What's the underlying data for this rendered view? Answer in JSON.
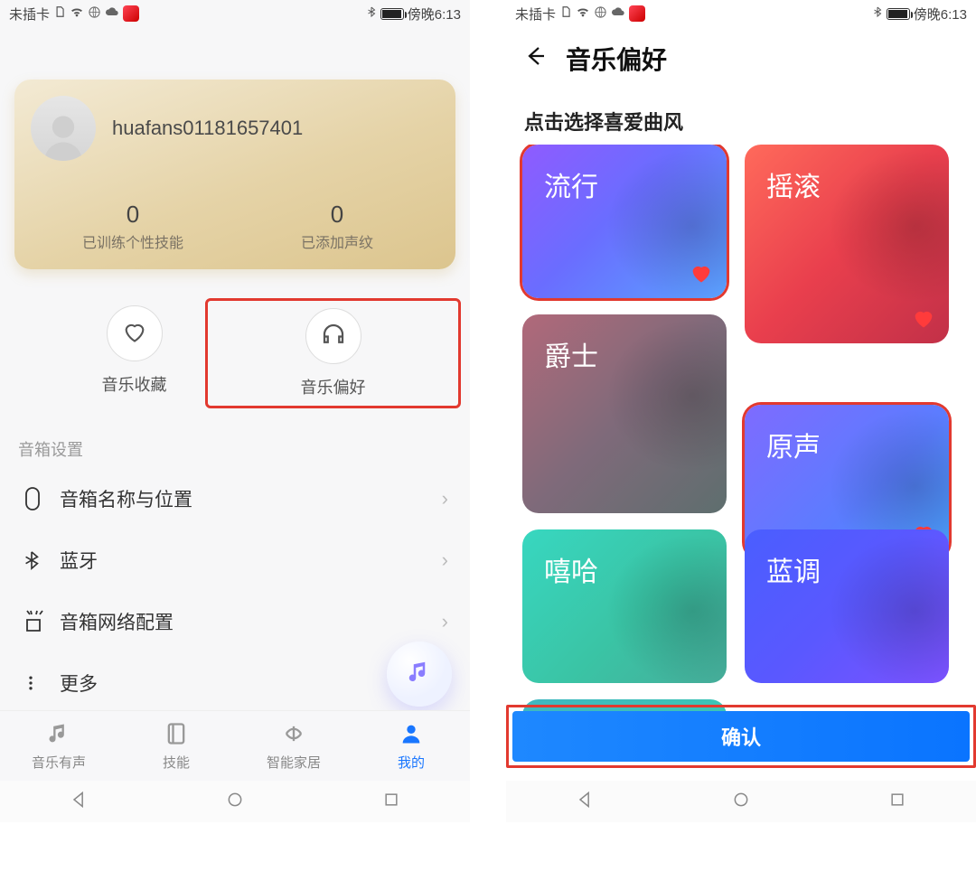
{
  "status": {
    "sim_text": "未插卡",
    "time_text": "傍晚6:13"
  },
  "left": {
    "username": "huafans01181657401",
    "stats": [
      {
        "value": "0",
        "label": "已训练个性技能"
      },
      {
        "value": "0",
        "label": "已添加声纹"
      }
    ],
    "round_actions": [
      {
        "label": "音乐收藏",
        "icon": "heart"
      },
      {
        "label": "音乐偏好",
        "icon": "headphones"
      }
    ],
    "section_title": "音箱设置",
    "settings": [
      {
        "label": "音箱名称与位置",
        "icon": "speaker"
      },
      {
        "label": "蓝牙",
        "icon": "bluetooth"
      },
      {
        "label": "音箱网络配置",
        "icon": "router"
      },
      {
        "label": "更多",
        "icon": "more"
      }
    ],
    "tabs": [
      {
        "label": "音乐有声",
        "icon": "music"
      },
      {
        "label": "技能",
        "icon": "book"
      },
      {
        "label": "智能家居",
        "icon": "home"
      },
      {
        "label": "我的",
        "icon": "person",
        "active": true
      }
    ]
  },
  "right": {
    "header_title": "音乐偏好",
    "sub_title": "点击选择喜爱曲风",
    "genres": [
      {
        "name": "流行",
        "key": "popular",
        "liked": true,
        "highlighted": true
      },
      {
        "name": "摇滚",
        "key": "rock",
        "liked": true,
        "highlighted": false
      },
      {
        "name": "爵士",
        "key": "jazz",
        "liked": false,
        "highlighted": false
      },
      {
        "name": "原声",
        "key": "soundtrack",
        "liked": true,
        "highlighted": true
      },
      {
        "name": "嘻哈",
        "key": "hiphop",
        "liked": false,
        "highlighted": false
      },
      {
        "name": "蓝调",
        "key": "blues",
        "liked": false,
        "highlighted": false
      }
    ],
    "confirm_label": "确认"
  }
}
